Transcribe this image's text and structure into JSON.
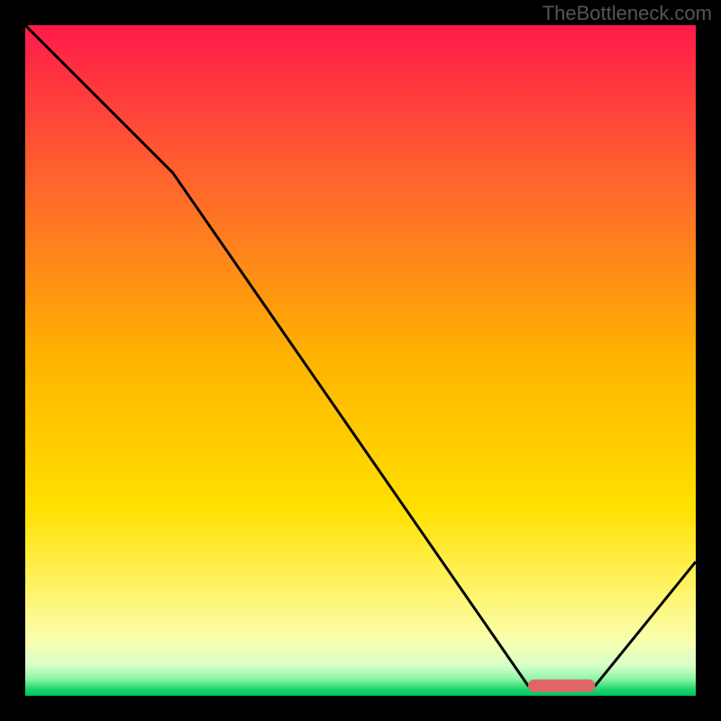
{
  "watermark": "TheBottleneck.com",
  "chart_data": {
    "type": "line",
    "title": "",
    "xlabel": "",
    "ylabel": "",
    "xlim": [
      0,
      100
    ],
    "ylim": [
      0,
      100
    ],
    "series": [
      {
        "name": "curve",
        "x": [
          0,
          22,
          75,
          80,
          85,
          100
        ],
        "values": [
          100,
          78,
          1.5,
          1.5,
          1.5,
          20
        ]
      }
    ],
    "marker": {
      "x_start": 75,
      "x_end": 85,
      "y": 1.5
    },
    "gradient_stops": [
      {
        "offset": 0.0,
        "color": "#ff1a4a"
      },
      {
        "offset": 0.25,
        "color": "#ff6a2a"
      },
      {
        "offset": 0.5,
        "color": "#ffb400"
      },
      {
        "offset": 0.72,
        "color": "#ffe000"
      },
      {
        "offset": 0.85,
        "color": "#fff570"
      },
      {
        "offset": 0.92,
        "color": "#f8ffb0"
      },
      {
        "offset": 0.955,
        "color": "#d8ffc8"
      },
      {
        "offset": 0.975,
        "color": "#8cf5a6"
      },
      {
        "offset": 0.99,
        "color": "#1fd66b"
      },
      {
        "offset": 1.0,
        "color": "#00c060"
      }
    ],
    "marker_color": "#e06666"
  }
}
